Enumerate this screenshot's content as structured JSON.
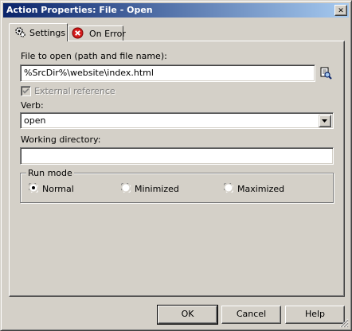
{
  "window": {
    "title": "Action Properties: File - Open",
    "close_glyph": "✕"
  },
  "tabs": [
    {
      "label": "Settings",
      "icon": "gear-icon",
      "selected": true
    },
    {
      "label": "On Error",
      "icon": "error-icon",
      "selected": false
    }
  ],
  "settings": {
    "file_label": "File to open (path and file name):",
    "file_value": "%SrcDir%\\website\\index.html",
    "external_reference_label": "External reference",
    "external_reference_checked": true,
    "external_reference_enabled": false,
    "verb_label": "Verb:",
    "verb_value": "open",
    "working_directory_label": "Working directory:",
    "working_directory_value": "",
    "run_mode": {
      "label": "Run mode",
      "options": [
        {
          "label": "Normal",
          "selected": true
        },
        {
          "label": "Minimized",
          "selected": false
        },
        {
          "label": "Maximized",
          "selected": false
        }
      ]
    }
  },
  "buttons": {
    "ok": "OK",
    "cancel": "Cancel",
    "help": "Help"
  },
  "colors": {
    "titlebar_start": "#0a246a",
    "titlebar_end": "#a6caf0",
    "face": "#d4d0c8",
    "error_red": "#d41c1c"
  }
}
